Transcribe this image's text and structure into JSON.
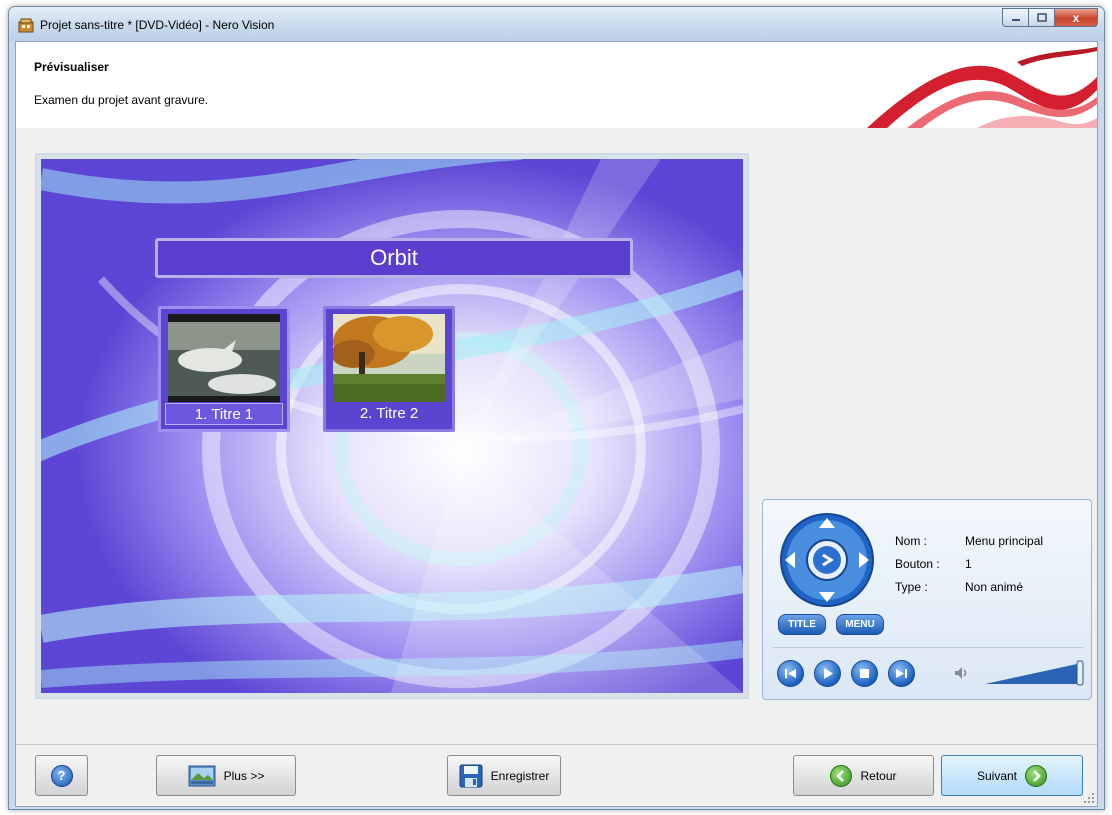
{
  "window": {
    "title": "Projet sans-titre * [DVD-Vidéo] - Nero Vision",
    "icon": "nero-vision-app-icon",
    "controls": [
      "minimize-icon",
      "maximize-icon",
      "close-icon"
    ],
    "close_glyph": "x"
  },
  "header": {
    "title": "Prévisualiser",
    "subtitle": "Examen du projet avant gravure.",
    "brand_color": "#d41f2f"
  },
  "preview": {
    "menu_title": "Orbit",
    "buttons": [
      {
        "label": "1. Titre 1",
        "thumbnail": "beluga-whales"
      },
      {
        "label": "2. Titre 2",
        "thumbnail": "autumn-tree-landscape"
      }
    ],
    "background_color": "#6d55d8"
  },
  "remote": {
    "info": [
      {
        "key": "Nom :",
        "value": "Menu principal"
      },
      {
        "key": "Bouton :",
        "value": "1"
      },
      {
        "key": "Type :",
        "value": "Non animé"
      }
    ],
    "title_button": "TITLE",
    "menu_button": "MENU",
    "playback": [
      "previous-icon",
      "play-icon",
      "stop-icon",
      "next-icon"
    ],
    "volume_icon": "speaker-icon",
    "volume_level": 1.0
  },
  "footer": {
    "help_icon": "help-icon",
    "plus_label": "Plus >>",
    "save_label": "Enregistrer",
    "back_label": "Retour",
    "next_label": "Suivant"
  }
}
